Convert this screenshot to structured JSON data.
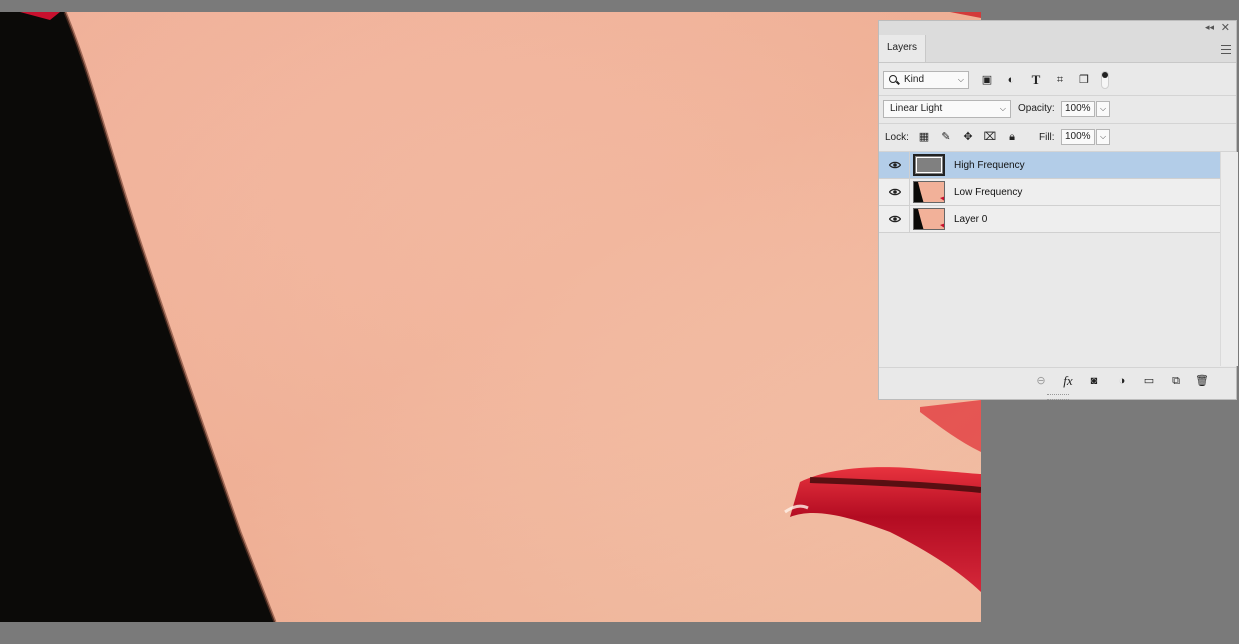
{
  "panel": {
    "tab_label": "Layers",
    "collapse_icon": "double-chevron-left-icon",
    "close_icon": "close-icon",
    "menu_icon": "hamburger-menu-icon"
  },
  "filter": {
    "kind_label": "Kind",
    "icons": [
      "image-filter-icon",
      "adjustment-filter-icon",
      "type-filter-icon",
      "shape-filter-icon",
      "smart-object-filter-icon",
      "filter-toggle-icon"
    ]
  },
  "blend": {
    "mode": "Linear Light",
    "opacity_label": "Opacity:",
    "opacity_value": "100%"
  },
  "lock": {
    "lock_label": "Lock:",
    "fill_label": "Fill:",
    "fill_value": "100%",
    "icons": [
      "lock-transparent-pixels-icon",
      "lock-image-pixels-icon",
      "lock-position-icon",
      "lock-artboard-icon",
      "lock-all-icon"
    ]
  },
  "layers": [
    {
      "name": "High Frequency",
      "selected": true,
      "visible": true,
      "thumb": "gray"
    },
    {
      "name": "Low Frequency",
      "selected": false,
      "visible": true,
      "thumb": "photo"
    },
    {
      "name": "Layer 0",
      "selected": false,
      "visible": true,
      "thumb": "photo"
    }
  ],
  "bottom_icons": [
    "link-layers-icon",
    "fx-icon",
    "layer-mask-icon",
    "adjustment-layer-icon",
    "group-folder-icon",
    "new-layer-icon",
    "trash-icon"
  ],
  "colors": {
    "selected_row": "#b3cde8",
    "skin": "#f1b39a",
    "lips": "#c8102e",
    "background": "#0b0a08"
  }
}
